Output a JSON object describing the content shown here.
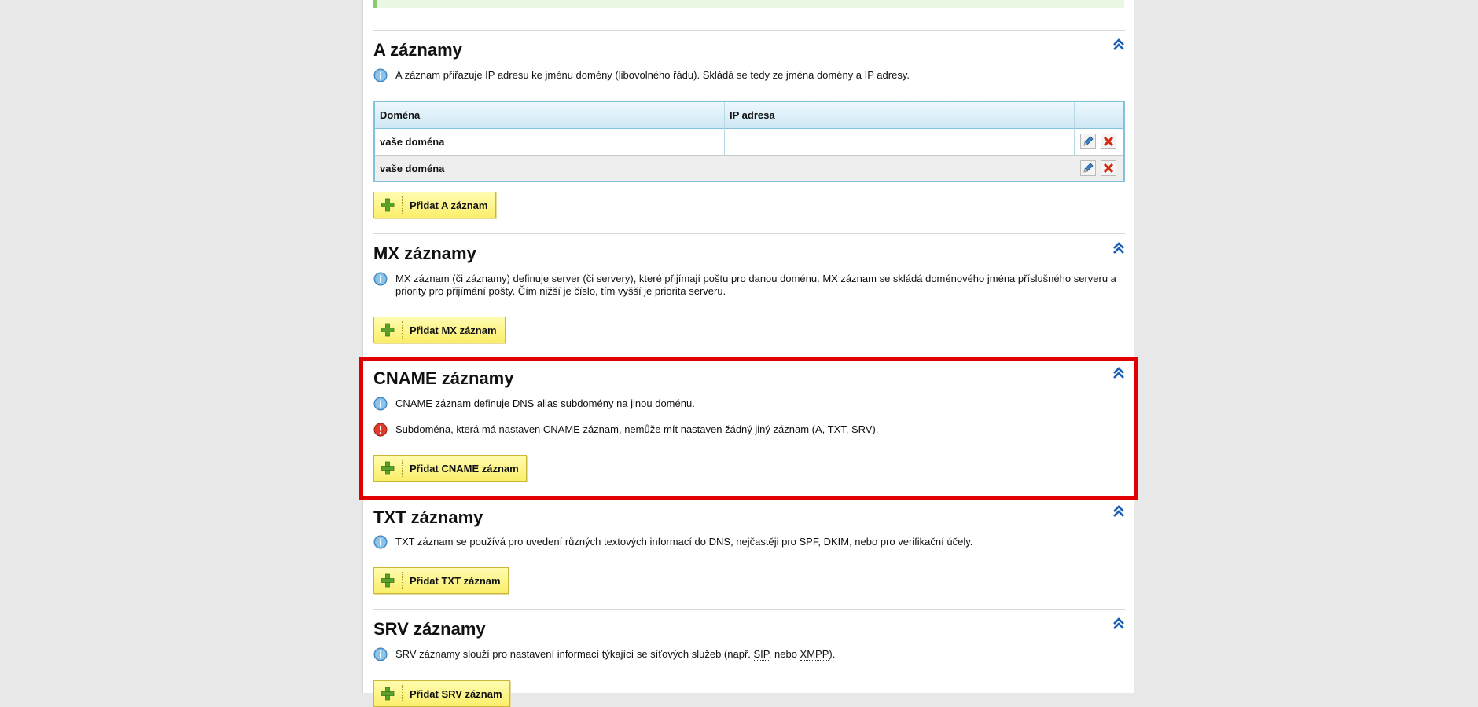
{
  "sections": {
    "a": {
      "title": "A záznamy",
      "info": "A záznam přiřazuje IP adresu ke jménu domény (libovolného řádu). Skládá se tedy ze jména domény a IP adresy.",
      "table": {
        "headers": [
          "Doména",
          "IP adresa",
          ""
        ],
        "rows": [
          {
            "domain": "vaše doména",
            "ip": ""
          },
          {
            "domain": "vaše doména",
            "ip": ""
          }
        ]
      },
      "add_label": "Přidat A záznam"
    },
    "mx": {
      "title": "MX záznamy",
      "info": "MX záznam (či záznamy) definuje server (či servery), které přijímají poštu pro danou doménu. MX záznam se skládá doménového jména příslušného serveru a priority pro přijímání pošty. Čím nižší je číslo, tím vyšší je priorita serveru.",
      "add_label": "Přidat MX záznam"
    },
    "cname": {
      "title": "CNAME záznamy",
      "info": "CNAME záznam definuje DNS alias subdomény na jinou doménu.",
      "warning": "Subdoména, která má nastaven CNAME záznam, nemůže mít nastaven žádný jiný záznam (A, TXT, SRV).",
      "add_label": "Přidat CNAME záznam"
    },
    "txt": {
      "title": "TXT záznamy",
      "info_pre": "TXT záznam se používá pro uvedení různých textových informací do DNS, nejčastěji pro ",
      "abbr1": "SPF",
      "info_mid": ", ",
      "abbr2": "DKIM",
      "info_post": ", nebo pro verifikační účely.",
      "add_label": "Přidat TXT záznam"
    },
    "srv": {
      "title": "SRV záznamy",
      "info_pre": "SRV záznamy slouží pro nastavení informací týkající se síťových služeb (např. ",
      "abbr1": "SIP",
      "info_mid": ", nebo ",
      "abbr2": "XMPP",
      "info_post": ").",
      "add_label": "Přidat SRV záznam"
    }
  },
  "icons": {
    "info": "info-icon",
    "warning": "warning-icon",
    "collapse": "double-chevron-up-icon",
    "edit": "pencil-icon",
    "delete": "red-x-icon",
    "add": "green-plus-icon"
  },
  "colors": {
    "highlight": "#e00000",
    "button": "#fbee6b",
    "table_border": "#83c1dc",
    "collapse": "#1a5fb4"
  }
}
